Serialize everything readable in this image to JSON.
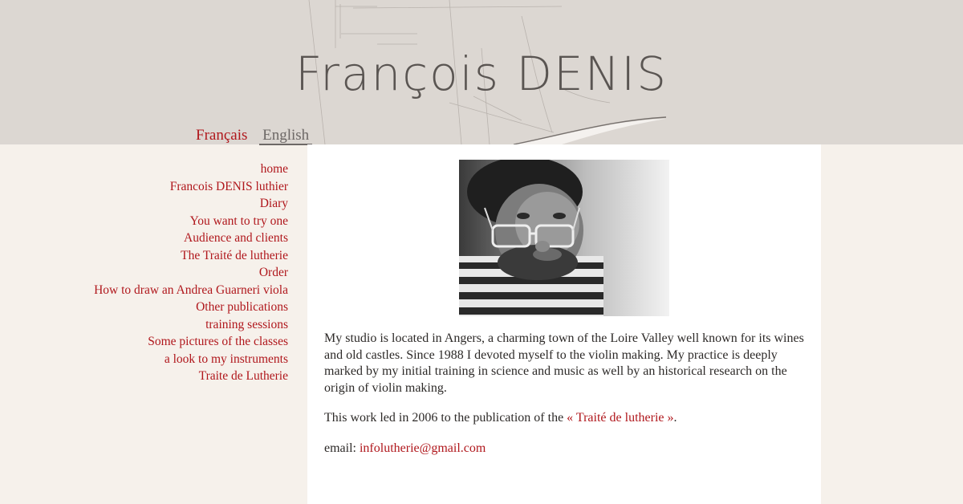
{
  "site": {
    "title": "François DENIS"
  },
  "languages": {
    "fr": "Français",
    "en": "English"
  },
  "nav": [
    "home",
    "Francois DENIS luthier",
    "Diary",
    "You want to try one",
    "Audience and clients",
    "The Traité de lutherie",
    "Order",
    "How to draw an Andrea Guarneri viola",
    "Other publications",
    "training sessions",
    "Some pictures of the classes",
    "a look to my instruments",
    "Traite de Lutherie"
  ],
  "content": {
    "paragraph1": "My studio is located in Angers, a charming town of the Loire Valley well known for its wines and old castles. Since 1988 I devoted myself to the violin making. My practice is deeply marked by my initial training in science and music as well by an historical research on the origin of violin making.",
    "paragraph2_prefix": "This work led in 2006 to the publication of the ",
    "paragraph2_link": "« Traité de lutherie »",
    "paragraph2_suffix": ".",
    "email_label": "email: ",
    "email_value": "infolutherie@gmail.com"
  },
  "colors": {
    "accent": "#b0171c",
    "header_bg": "#dcd7d2",
    "page_bg": "#f6f1eb",
    "content_bg": "#ffffff",
    "text": "#2d2a28"
  }
}
